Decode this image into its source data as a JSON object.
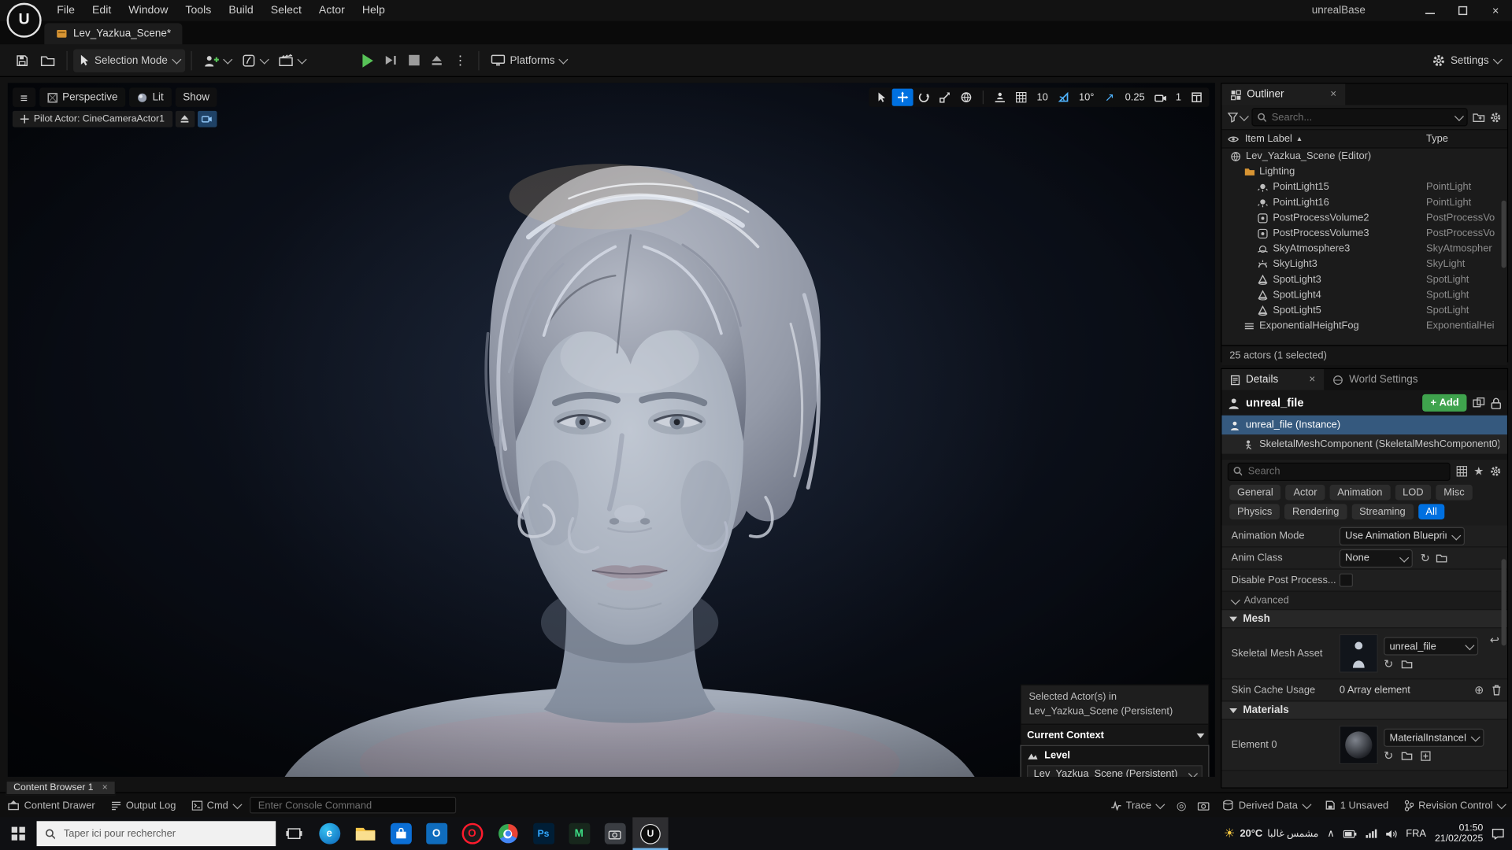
{
  "window": {
    "title": "unrealBase",
    "menu": [
      "File",
      "Edit",
      "Window",
      "Tools",
      "Build",
      "Select",
      "Actor",
      "Help"
    ]
  },
  "tabbar": {
    "level_tab": "Lev_Yazkua_Scene*"
  },
  "toolbar": {
    "selection_mode": "Selection Mode",
    "platforms": "Platforms",
    "settings": "Settings"
  },
  "viewport": {
    "perspective": "Perspective",
    "lit": "Lit",
    "show": "Show",
    "pilot": "Pilot Actor: CineCameraActor1",
    "snap_grid": "10",
    "snap_rotation": "10°",
    "snap_scale": "0.25",
    "camera_speed": "1"
  },
  "outliner": {
    "title": "Outliner",
    "search_placeholder": "Search...",
    "col_label": "Item Label",
    "col_type": "Type",
    "rows": [
      {
        "label": "Lev_Yazkua_Scene (Editor)",
        "type": ""
      },
      {
        "label": "Lighting",
        "type": ""
      },
      {
        "label": "PointLight15",
        "type": "PointLight"
      },
      {
        "label": "PointLight16",
        "type": "PointLight"
      },
      {
        "label": "PostProcessVolume2",
        "type": "PostProcessVo"
      },
      {
        "label": "PostProcessVolume3",
        "type": "PostProcessVo"
      },
      {
        "label": "SkyAtmosphere3",
        "type": "SkyAtmospher"
      },
      {
        "label": "SkyLight3",
        "type": "SkyLight"
      },
      {
        "label": "SpotLight3",
        "type": "SpotLight"
      },
      {
        "label": "SpotLight4",
        "type": "SpotLight"
      },
      {
        "label": "SpotLight5",
        "type": "SpotLight"
      },
      {
        "label": "ExponentialHeightFog",
        "type": "ExponentialHei"
      }
    ],
    "footer": "25 actors (1 selected)"
  },
  "details": {
    "tab": "Details",
    "tab_world": "World Settings",
    "actor_name": "unreal_file",
    "add": "Add",
    "instance": "unreal_file (Instance)",
    "component": "SkeletalMeshComponent (SkeletalMeshComponent0)",
    "search_placeholder": "Search",
    "filters1": [
      "General",
      "Actor",
      "Animation",
      "LOD",
      "Misc"
    ],
    "filters2": [
      "Physics",
      "Rendering",
      "Streaming",
      "All"
    ],
    "anim_mode_label": "Animation Mode",
    "anim_mode_value": "Use Animation Blueprint",
    "anim_class_label": "Anim Class",
    "anim_class_value": "None",
    "disable_pp_label": "Disable Post Process...",
    "advanced": "Advanced",
    "mesh_section": "Mesh",
    "skel_label": "Skeletal Mesh Asset",
    "skel_value": "unreal_file",
    "skin_label": "Skin Cache Usage",
    "skin_value": "0 Array element",
    "materials_section": "Materials",
    "elem_label": "Element 0",
    "elem_value": "MaterialInstanceDyna"
  },
  "popup": {
    "line1": "Selected Actor(s) in",
    "line2": "Lev_Yazkua_Scene (Persistent)",
    "context": "Current Context",
    "level": "Level",
    "level_value": "Lev_Yazkua_Scene (Persistent)"
  },
  "statusbar": {
    "content_browser": "Content Browser 1",
    "content_drawer": "Content Drawer",
    "output_log": "Output Log",
    "cmd": "Cmd",
    "console_placeholder": "Enter Console Command",
    "trace": "Trace",
    "derived_data": "Derived Data",
    "unsaved": "1 Unsaved",
    "revision": "Revision Control"
  },
  "taskbar": {
    "search_placeholder": "Taper ici pour rechercher",
    "weather_temp": "20°C",
    "weather_desc": "مشمس غالبا",
    "lang": "FRA",
    "time": "01:50",
    "date": "21/02/2025",
    "app_glyphs": {
      "edge": "e",
      "outlook": "O",
      "opera": "O",
      "photoshop": "Ps",
      "m_app": "M",
      "unreal": "U"
    }
  },
  "icons": {
    "hamburger": "≡",
    "kebab": "⋮",
    "star": "★",
    "circle_plus": "⊕",
    "use_arrow": "↻",
    "reset_arrow": "↩",
    "close": "×",
    "arrow_ne": "↗",
    "sun": "☀",
    "chevron_up": "∧",
    "sort_asc": "▲",
    "plus": "+",
    "target": "◎",
    "logo": "U"
  }
}
